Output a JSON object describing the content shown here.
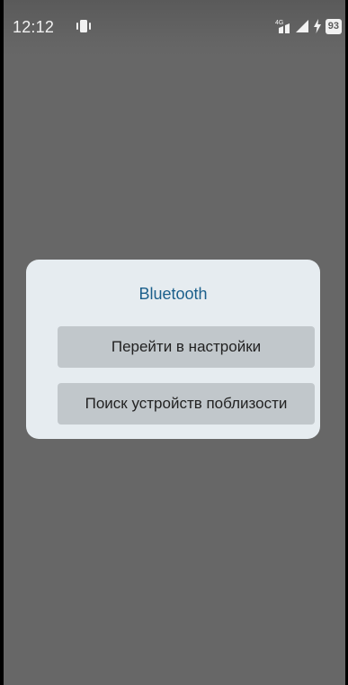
{
  "status_bar": {
    "time": "12:12",
    "vibrate_icon": "vibrate-icon",
    "network_label": "4G",
    "signal_icon": "signal-icon",
    "charging_icon": "bolt-icon",
    "battery": "93"
  },
  "dialog": {
    "title": "Bluetooth",
    "buttons": [
      {
        "label": "Перейти в настройки"
      },
      {
        "label": "Поиск устройств поблизости"
      }
    ]
  },
  "colors": {
    "background_dim": "#676767",
    "dialog_bg": "#e6ecf0",
    "title_color": "#1b5f8b",
    "button_bg": "#c1c7cb"
  }
}
